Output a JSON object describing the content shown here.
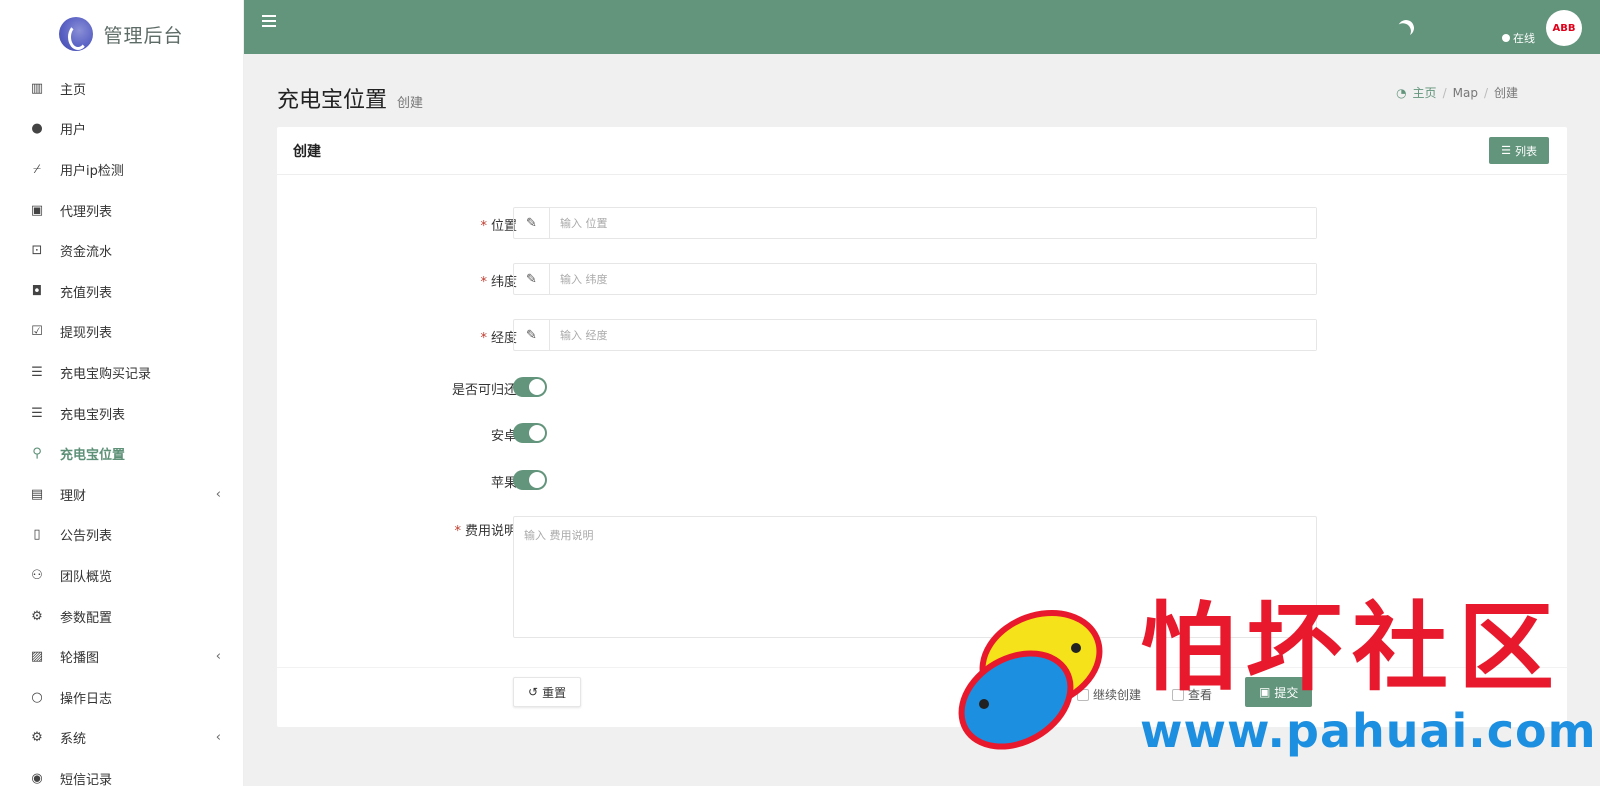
{
  "app": {
    "title": "管理后台"
  },
  "sidebar": {
    "items": [
      {
        "label": "主页",
        "icon": "bar-chart-icon"
      },
      {
        "label": "用户",
        "icon": "user-icon"
      },
      {
        "label": "用户ip检测",
        "icon": "broom-icon"
      },
      {
        "label": "代理列表",
        "icon": "contact-book-icon"
      },
      {
        "label": "资金流水",
        "icon": "money-bill-icon"
      },
      {
        "label": "充值列表",
        "icon": "font-box-icon"
      },
      {
        "label": "提现列表",
        "icon": "check-square-icon"
      },
      {
        "label": "充电宝购买记录",
        "icon": "list-icon"
      },
      {
        "label": "充电宝列表",
        "icon": "indent-list-icon"
      },
      {
        "label": "充电宝位置",
        "icon": "map-marker-icon",
        "active": true
      },
      {
        "label": "理财",
        "icon": "archive-icon",
        "has_children": true
      },
      {
        "label": "公告列表",
        "icon": "file-text-icon"
      },
      {
        "label": "团队概览",
        "icon": "users-icon"
      },
      {
        "label": "参数配置",
        "icon": "gears-icon"
      },
      {
        "label": "轮播图",
        "icon": "image-icon",
        "has_children": true
      },
      {
        "label": "操作日志",
        "icon": "circle-icon"
      },
      {
        "label": "系统",
        "icon": "gear-icon",
        "has_children": true
      },
      {
        "label": "短信记录",
        "icon": "comment-icon"
      }
    ]
  },
  "header": {
    "status_text": "在线",
    "avatar_text": "ABB"
  },
  "page": {
    "title": "充电宝位置",
    "subtitle": "创建",
    "breadcrumb": [
      "主页",
      "Map",
      "创建"
    ]
  },
  "card": {
    "title": "创建",
    "list_button": "列表"
  },
  "form": {
    "location": {
      "label": "位置",
      "placeholder": "输入 位置",
      "value": ""
    },
    "latitude": {
      "label": "纬度",
      "placeholder": "输入 纬度",
      "value": ""
    },
    "longitude": {
      "label": "经度",
      "placeholder": "输入 经度",
      "value": ""
    },
    "returnable": {
      "label": "是否可归还",
      "on": true
    },
    "android": {
      "label": "安卓",
      "on": true
    },
    "apple": {
      "label": "苹果",
      "on": true
    },
    "fee": {
      "label": "费用说明",
      "placeholder": "输入 费用说明",
      "value": ""
    }
  },
  "footer": {
    "reset_label": "重置",
    "continue_edit_label": "继续",
    "continue_create_label": "继续创建",
    "view_label": "查看",
    "submit_label": "提交"
  },
  "watermark": {
    "title": "怕坏社区",
    "url": "www.pahuai.com"
  },
  "colors": {
    "accent": "#63957c",
    "required": "#c0392b",
    "watermark_red": "#e8192c",
    "watermark_blue": "#1c8fe0"
  }
}
